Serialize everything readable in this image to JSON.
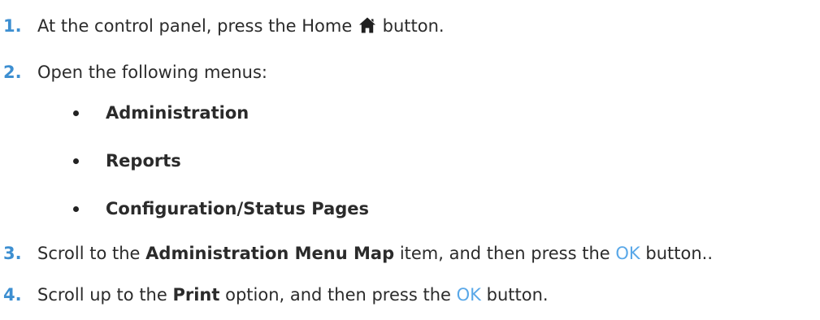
{
  "steps": [
    {
      "number": "1.",
      "text_before_icon": "At the control panel, press the Home",
      "icon": "home-icon",
      "text_after_icon": "button."
    },
    {
      "number": "2.",
      "text": "Open the following menus:",
      "submenus": [
        "Administration",
        "Reports",
        "Configuration/Status Pages"
      ]
    },
    {
      "number": "3.",
      "text_before": "Scroll to the",
      "bold": "Administration Menu Map",
      "text_middle": "item, and then press the",
      "ok": "OK",
      "text_after": "button.."
    },
    {
      "number": "4.",
      "text_before": "Scroll up to the",
      "bold": "Print",
      "text_middle": "option, and then press the",
      "ok": "OK",
      "text_after": "button."
    }
  ],
  "colors": {
    "step_number": "#3d8fd1",
    "ok_text": "#5aa8e8",
    "body_text": "#2b2b2b"
  }
}
